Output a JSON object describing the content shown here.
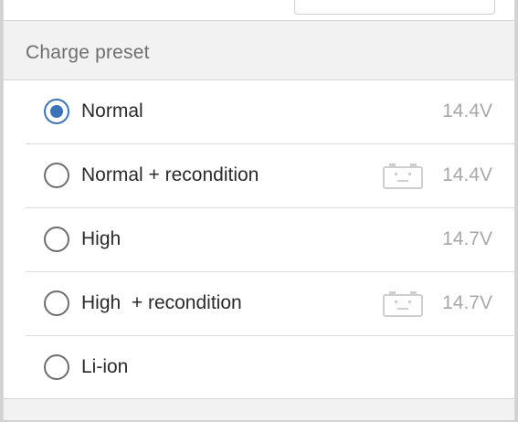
{
  "section": {
    "title": "Charge preset"
  },
  "presets": [
    {
      "label": "Normal",
      "voltage": "14.4V",
      "selected": true,
      "recondition_icon": false
    },
    {
      "label": "Normal + recondition",
      "voltage": "14.4V",
      "selected": false,
      "recondition_icon": true
    },
    {
      "label": "High",
      "voltage": "14.7V",
      "selected": false,
      "recondition_icon": false
    },
    {
      "label": "High  + recondition",
      "voltage": "14.7V",
      "selected": false,
      "recondition_icon": true
    },
    {
      "label": "Li-ion",
      "voltage": "",
      "selected": false,
      "recondition_icon": false
    }
  ],
  "icons": {
    "recondition": "battery-recondition-icon",
    "radio_selected": "radio-selected-icon",
    "radio_unselected": "radio-unselected-icon"
  },
  "colors": {
    "accent": "#3a73b7",
    "header_bg": "#f2f2f2",
    "voltage_text": "#a8a8a8",
    "label_text": "#2a2a2a"
  }
}
